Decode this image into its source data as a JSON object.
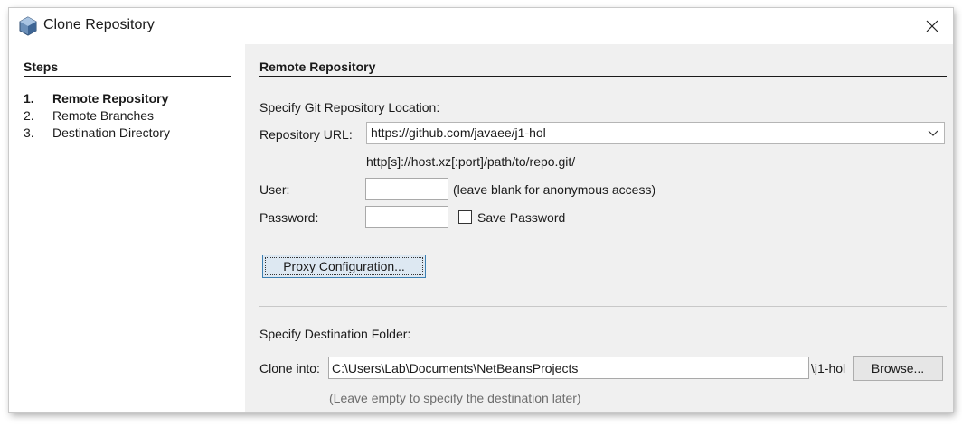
{
  "window": {
    "title": "Clone Repository"
  },
  "steps": {
    "header": "Steps",
    "items": [
      {
        "num": "1.",
        "label": "Remote Repository"
      },
      {
        "num": "2.",
        "label": "Remote Branches"
      },
      {
        "num": "3.",
        "label": "Destination Directory"
      }
    ]
  },
  "remote": {
    "section_title": "Remote Repository",
    "specify_label": "Specify Git Repository Location:",
    "url_label": "Repository URL:",
    "url_value": "https://github.com/javaee/j1-hol",
    "url_format_hint": "http[s]://host.xz[:port]/path/to/repo.git/",
    "user_label": "User:",
    "user_value": "",
    "user_hint": "(leave blank for anonymous access)",
    "password_label": "Password:",
    "password_value": "",
    "save_password_label": "Save Password",
    "save_password_checked": false,
    "proxy_button": "Proxy Configuration..."
  },
  "destination": {
    "specify_label": "Specify Destination Folder:",
    "clone_into_label": "Clone into:",
    "clone_into_value": "C:\\Users\\Lab\\Documents\\NetBeansProjects",
    "suffix": "\\j1-hol",
    "browse_button": "Browse...",
    "empty_hint": "(Leave empty to specify the destination later)"
  },
  "colors": {
    "content_bg": "#f0f0f0",
    "focus_border": "#3c7fb1"
  }
}
